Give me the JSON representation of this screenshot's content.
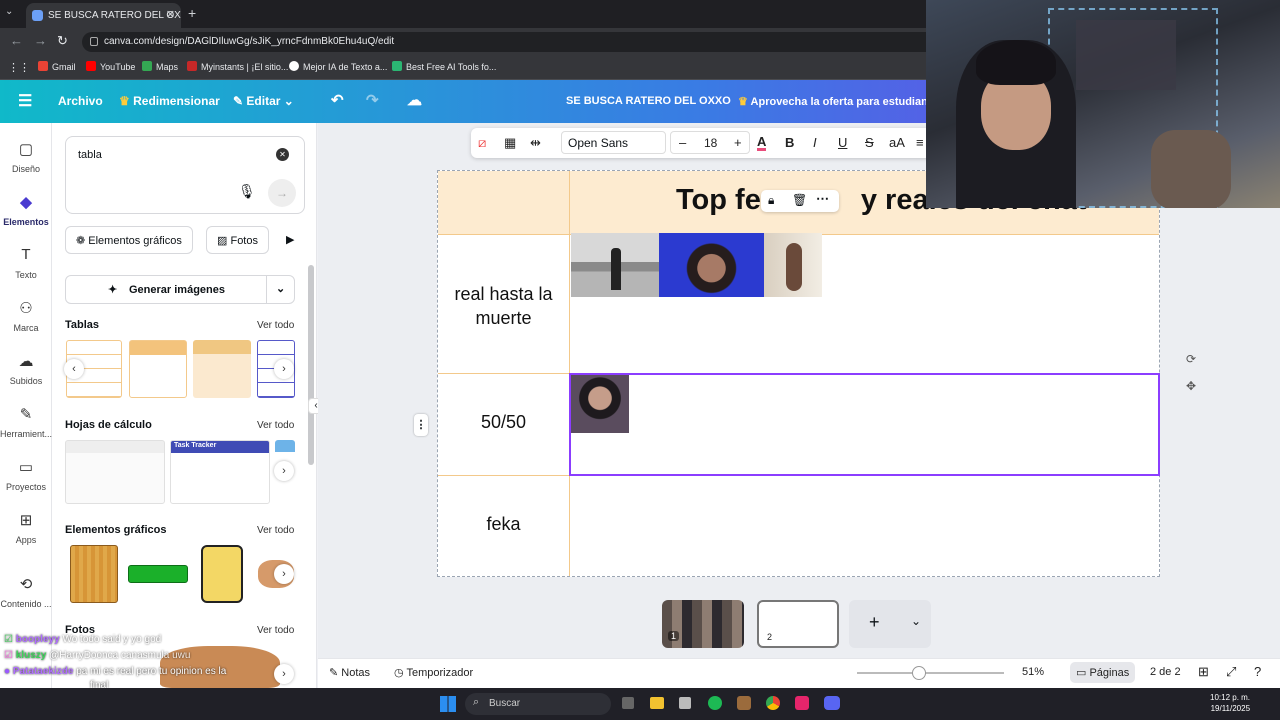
{
  "browser": {
    "tab_title": "SE BUSCA RATERO DEL OXXO",
    "url": "canva.com/design/DAGlDIluwGg/sJiK_yrncFdnmBk0Ehu4uQ/edit",
    "bookmarks": [
      "Gmail",
      "YouTube",
      "Maps",
      "Myinstants | ¡El sitio...",
      "Mejor IA de Texto a...",
      "Best Free AI Tools fo..."
    ]
  },
  "header": {
    "archivo": "Archivo",
    "redimensionar": "Redimensionar",
    "editar": "Editar",
    "design_title": "SE BUSCA RATERO DEL OXXO",
    "promo": "Aprovecha la oferta para estudiant"
  },
  "rail": [
    "Diseño",
    "Elementos",
    "Texto",
    "Marca",
    "Subidos",
    "Herramient...",
    "Proyectos",
    "Apps",
    "Contenido ..."
  ],
  "panel": {
    "search_value": "tabla",
    "chips": [
      "Elementos gráficos",
      "Fotos"
    ],
    "generate": "Generar imágenes",
    "sections": {
      "tablas": "Tablas",
      "hojas": "Hojas de cálculo",
      "elementos": "Elementos gráficos",
      "fotos": "Fotos"
    },
    "see_all": "Ver todo",
    "task_tracker": "Task Tracker"
  },
  "toolbar": {
    "font": "Open Sans",
    "size": "18",
    "minus": "–",
    "plus": "+",
    "bold": "B",
    "italic": "I",
    "underline": "U",
    "strike": "S",
    "case": "aA"
  },
  "table": {
    "title": "Top fe",
    "title_end": "y reales del chat",
    "rows": [
      "real hasta la muerte",
      "50/50",
      "feka"
    ]
  },
  "bottom": {
    "notes": "Notas",
    "timer": "Temporizador",
    "zoom": "51%",
    "pages": "Páginas",
    "page_count": "2 de 2",
    "page1": "1",
    "page2": "2"
  },
  "taskbar": {
    "search": "Buscar",
    "time": "10:12 p. m.",
    "date": "19/11/2025"
  },
  "chat": [
    {
      "user": "boopleyy",
      "msg": "Wo todo said y yo god"
    },
    {
      "user": "kluszy",
      "msg": "@HarryDoonca canasmula uwu"
    },
    {
      "user": "Patataekizde",
      "msg": "pa mi es real pero tu opinion es la"
    },
    {
      "user": "",
      "msg": "final"
    }
  ],
  "colors": {
    "accent": "#8b3dff",
    "table_header": "#fdebd0",
    "table_border": "#f3c98b"
  }
}
